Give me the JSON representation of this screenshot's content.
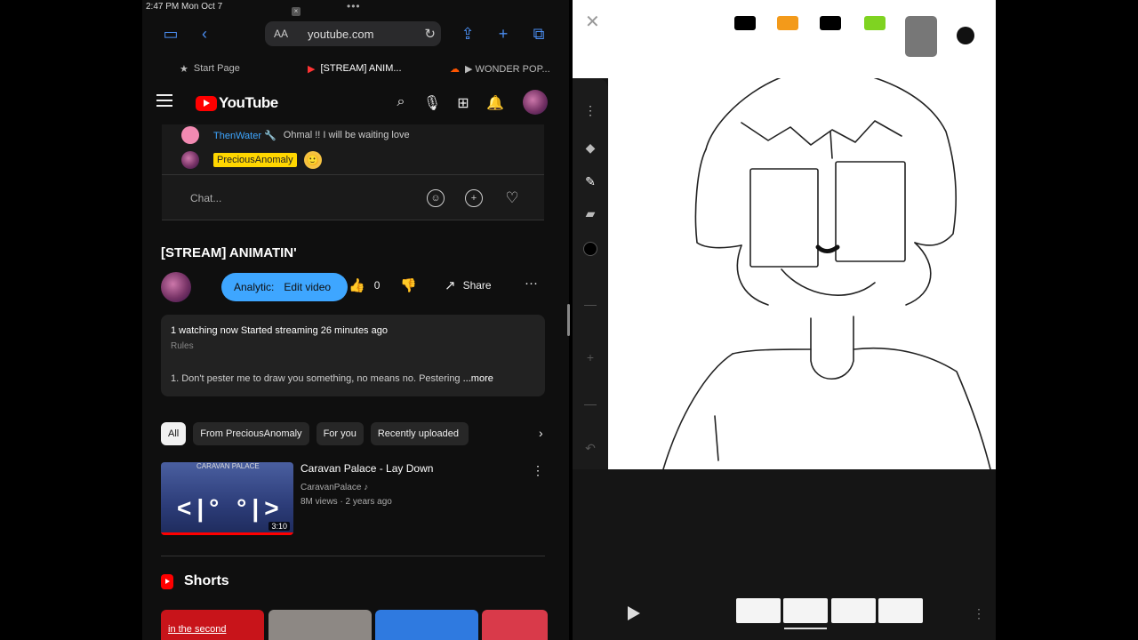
{
  "status": {
    "time": "2:47 PM  Mon Oct 7"
  },
  "safari": {
    "address": "youtube.com",
    "aa_label": "AA",
    "tabs": [
      {
        "label": "Start Page"
      },
      {
        "label": "[STREAM] ANIM..."
      },
      {
        "label": "▶ WONDER POP..."
      }
    ]
  },
  "youtube": {
    "logo_text": "YouTube",
    "chat": {
      "msg1_name": "ThenWater 🔧",
      "msg1_text": "Ohmal !! I will be waiting love",
      "msg2_name": "PreciousAnomaly",
      "msg2_emoji": "🙂",
      "placeholder": "Chat..."
    },
    "video": {
      "title": "[STREAM] ANIMATIN'",
      "analytics": "Analytic:",
      "edit": "Edit video",
      "likes": "0",
      "share": "Share"
    },
    "description": {
      "line1": "1 watching now  Started streaming 26 minutes ago",
      "line2": "Rules",
      "line3": "1. Don't pester me to draw you something, no means no. Pestering",
      "more": " ...more"
    },
    "chips": [
      "All",
      "From PreciousAnomaly",
      "For you",
      "Recently uploaded"
    ],
    "recommended": {
      "title": "Caravan Palace - Lay Down",
      "channel": "CaravanPalace ♪",
      "meta": "8M views · 2 years ago",
      "duration": "3:10",
      "thumb_brand": "CARAVAN PALACE",
      "thumb_face": "<|° °|>"
    },
    "shorts": {
      "title": "Shorts",
      "first_text": "in the second"
    }
  },
  "drawing_app": {
    "swatches": [
      "#000000",
      "#f39a1a",
      "#000000",
      "#7fd321"
    ],
    "frames": 4
  }
}
